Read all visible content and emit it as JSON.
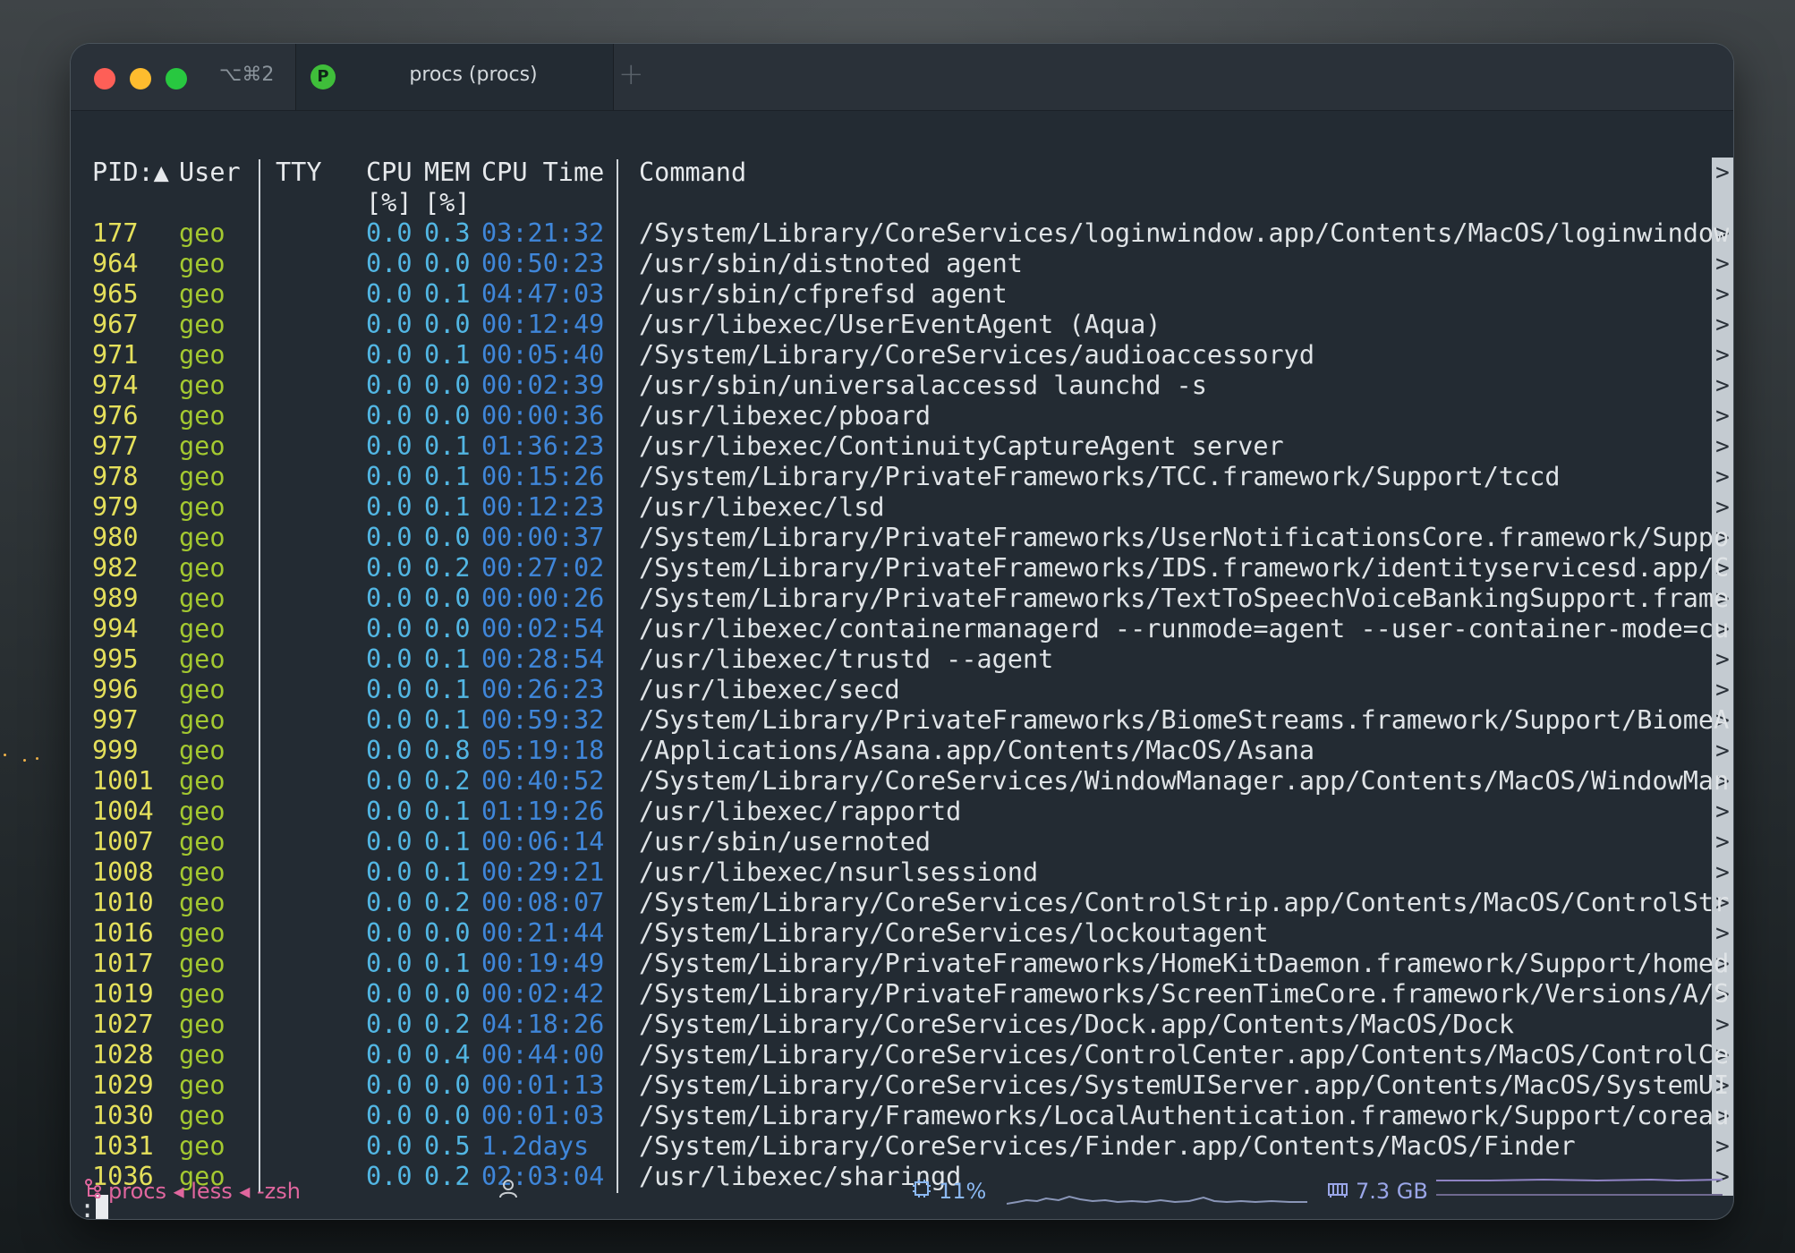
{
  "tab": {
    "shortcut": "⌥⌘2",
    "icon_letter": "P",
    "title": "procs (procs)",
    "new_tab_glyph": "+"
  },
  "columns": {
    "pid": "PID:▲",
    "user": "User",
    "tty": "TTY",
    "cpu": "CPU",
    "cpu_unit": "[%]",
    "mem": "MEM",
    "mem_unit": "[%]",
    "cpu_time": "CPU Time",
    "command": "Command"
  },
  "overflow_marker": ">",
  "rows": [
    {
      "pid": "177",
      "user": "geo",
      "cpu": "0.0",
      "mem": "0.3",
      "time": "03:21:32",
      "cmd": "/System/Library/CoreServices/loginwindow.app/Contents/MacOS/loginwindow con"
    },
    {
      "pid": "964",
      "user": "geo",
      "cpu": "0.0",
      "mem": "0.0",
      "time": "00:50:23",
      "cmd": "/usr/sbin/distnoted agent"
    },
    {
      "pid": "965",
      "user": "geo",
      "cpu": "0.0",
      "mem": "0.1",
      "time": "04:47:03",
      "cmd": "/usr/sbin/cfprefsd agent"
    },
    {
      "pid": "967",
      "user": "geo",
      "cpu": "0.0",
      "mem": "0.0",
      "time": "00:12:49",
      "cmd": "/usr/libexec/UserEventAgent (Aqua)"
    },
    {
      "pid": "971",
      "user": "geo",
      "cpu": "0.0",
      "mem": "0.1",
      "time": "00:05:40",
      "cmd": "/System/Library/CoreServices/audioaccessoryd"
    },
    {
      "pid": "974",
      "user": "geo",
      "cpu": "0.0",
      "mem": "0.0",
      "time": "00:02:39",
      "cmd": "/usr/sbin/universalaccessd launchd -s"
    },
    {
      "pid": "976",
      "user": "geo",
      "cpu": "0.0",
      "mem": "0.0",
      "time": "00:00:36",
      "cmd": "/usr/libexec/pboard"
    },
    {
      "pid": "977",
      "user": "geo",
      "cpu": "0.0",
      "mem": "0.1",
      "time": "01:36:23",
      "cmd": "/usr/libexec/ContinuityCaptureAgent server"
    },
    {
      "pid": "978",
      "user": "geo",
      "cpu": "0.0",
      "mem": "0.1",
      "time": "00:15:26",
      "cmd": "/System/Library/PrivateFrameworks/TCC.framework/Support/tccd"
    },
    {
      "pid": "979",
      "user": "geo",
      "cpu": "0.0",
      "mem": "0.1",
      "time": "00:12:23",
      "cmd": "/usr/libexec/lsd"
    },
    {
      "pid": "980",
      "user": "geo",
      "cpu": "0.0",
      "mem": "0.0",
      "time": "00:00:37",
      "cmd": "/System/Library/PrivateFrameworks/UserNotificationsCore.framework/Support/u"
    },
    {
      "pid": "982",
      "user": "geo",
      "cpu": "0.0",
      "mem": "0.2",
      "time": "00:27:02",
      "cmd": "/System/Library/PrivateFrameworks/IDS.framework/identityservicesd.app/Conte"
    },
    {
      "pid": "989",
      "user": "geo",
      "cpu": "0.0",
      "mem": "0.0",
      "time": "00:00:26",
      "cmd": "/System/Library/PrivateFrameworks/TextToSpeechVoiceBankingSupport.framework"
    },
    {
      "pid": "994",
      "user": "geo",
      "cpu": "0.0",
      "mem": "0.0",
      "time": "00:02:54",
      "cmd": "/usr/libexec/containermanagerd --runmode=agent --user-container-mode=curren"
    },
    {
      "pid": "995",
      "user": "geo",
      "cpu": "0.0",
      "mem": "0.1",
      "time": "00:28:54",
      "cmd": "/usr/libexec/trustd --agent"
    },
    {
      "pid": "996",
      "user": "geo",
      "cpu": "0.0",
      "mem": "0.1",
      "time": "00:26:23",
      "cmd": "/usr/libexec/secd"
    },
    {
      "pid": "997",
      "user": "geo",
      "cpu": "0.0",
      "mem": "0.1",
      "time": "00:59:32",
      "cmd": "/System/Library/PrivateFrameworks/BiomeStreams.framework/Support/BiomeAgent"
    },
    {
      "pid": "999",
      "user": "geo",
      "cpu": "0.0",
      "mem": "0.8",
      "time": "05:19:18",
      "cmd": "/Applications/Asana.app/Contents/MacOS/Asana"
    },
    {
      "pid": "1001",
      "user": "geo",
      "cpu": "0.0",
      "mem": "0.2",
      "time": "00:40:52",
      "cmd": "/System/Library/CoreServices/WindowManager.app/Contents/MacOS/WindowManager"
    },
    {
      "pid": "1004",
      "user": "geo",
      "cpu": "0.0",
      "mem": "0.1",
      "time": "01:19:26",
      "cmd": "/usr/libexec/rapportd"
    },
    {
      "pid": "1007",
      "user": "geo",
      "cpu": "0.0",
      "mem": "0.1",
      "time": "00:06:14",
      "cmd": "/usr/sbin/usernoted"
    },
    {
      "pid": "1008",
      "user": "geo",
      "cpu": "0.0",
      "mem": "0.1",
      "time": "00:29:21",
      "cmd": "/usr/libexec/nsurlsessiond"
    },
    {
      "pid": "1010",
      "user": "geo",
      "cpu": "0.0",
      "mem": "0.2",
      "time": "00:08:07",
      "cmd": "/System/Library/CoreServices/ControlStrip.app/Contents/MacOS/ControlStrip"
    },
    {
      "pid": "1016",
      "user": "geo",
      "cpu": "0.0",
      "mem": "0.0",
      "time": "00:21:44",
      "cmd": "/System/Library/CoreServices/lockoutagent"
    },
    {
      "pid": "1017",
      "user": "geo",
      "cpu": "0.0",
      "mem": "0.1",
      "time": "00:19:49",
      "cmd": "/System/Library/PrivateFrameworks/HomeKitDaemon.framework/Support/homed"
    },
    {
      "pid": "1019",
      "user": "geo",
      "cpu": "0.0",
      "mem": "0.0",
      "time": "00:02:42",
      "cmd": "/System/Library/PrivateFrameworks/ScreenTimeCore.framework/Versions/A/Scree"
    },
    {
      "pid": "1027",
      "user": "geo",
      "cpu": "0.0",
      "mem": "0.2",
      "time": "04:18:26",
      "cmd": "/System/Library/CoreServices/Dock.app/Contents/MacOS/Dock"
    },
    {
      "pid": "1028",
      "user": "geo",
      "cpu": "0.0",
      "mem": "0.4",
      "time": "00:44:00",
      "cmd": "/System/Library/CoreServices/ControlCenter.app/Contents/MacOS/ControlCenter"
    },
    {
      "pid": "1029",
      "user": "geo",
      "cpu": "0.0",
      "mem": "0.0",
      "time": "00:01:13",
      "cmd": "/System/Library/CoreServices/SystemUIServer.app/Contents/MacOS/SystemUIServ"
    },
    {
      "pid": "1030",
      "user": "geo",
      "cpu": "0.0",
      "mem": "0.0",
      "time": "00:01:03",
      "cmd": "/System/Library/Frameworks/LocalAuthentication.framework/Support/coreauthd"
    },
    {
      "pid": "1031",
      "user": "geo",
      "cpu": "0.0",
      "mem": "0.5",
      "time": "1.2days",
      "cmd": "/System/Library/CoreServices/Finder.app/Contents/MacOS/Finder"
    },
    {
      "pid": "1036",
      "user": "geo",
      "cpu": "0.0",
      "mem": "0.2",
      "time": "02:03:04",
      "cmd": "/usr/libexec/sharingd"
    }
  ],
  "prompt": ":",
  "status": {
    "process_chain": "procs ◂ less ◂ -zsh",
    "process_icon": "process-tree-icon",
    "user_icon": "user-icon",
    "cpu_icon": "cpu-chip-icon",
    "cpu": "11%",
    "mem_icon": "memory-icon",
    "mem": "7.3 GB"
  },
  "colors": {
    "pid": "#e5e05b",
    "user": "#a4c930",
    "cpu": "#52b6e3",
    "cpu_time": "#3f86d9",
    "process_chain": "#e0669e",
    "cpu_stat": "#8bb8f2",
    "mem_stat": "#9aa6e8"
  }
}
